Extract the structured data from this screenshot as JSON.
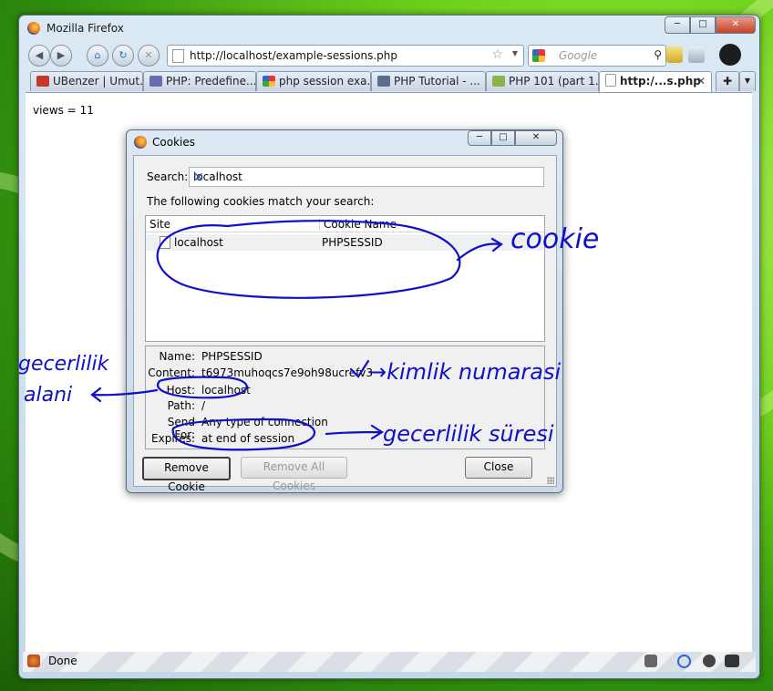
{
  "window": {
    "title": "Mozilla Firefox"
  },
  "nav": {
    "url": "http://localhost/example-sessions.php",
    "search_placeholder": "Google"
  },
  "tabs": [
    {
      "label": "UBenzer | Umut...",
      "icon_color": "#c0392b",
      "icon": "house-icon"
    },
    {
      "label": "PHP: Predefine...",
      "icon_color": "#6b6bb0",
      "icon": "php-icon"
    },
    {
      "label": "php session exa...",
      "icon_color": "#3a8ee6",
      "icon": "google-icon"
    },
    {
      "label": "PHP Tutorial - ...",
      "icon_color": "#5a6e8c",
      "icon": "tutorial-icon"
    },
    {
      "label": "PHP 101 (part 1...",
      "icon_color": "#8ab34a",
      "icon": "zzz-icon"
    },
    {
      "label": "http:/...s.php",
      "icon_color": "#ffffff",
      "icon": "page-icon"
    }
  ],
  "page": {
    "views_text": "views = 11"
  },
  "status": {
    "text": "Done"
  },
  "dialog": {
    "title": "Cookies",
    "search_label": "Search:",
    "search_value": "localhost",
    "match_text": "The following cookies match your search:",
    "columns": [
      "Site",
      "Cookie Name"
    ],
    "rows": [
      {
        "site": "localhost",
        "cookie": "PHPSESSID"
      }
    ],
    "details": [
      {
        "key": "Name:",
        "value": "PHPSESSID"
      },
      {
        "key": "Content:",
        "value": "t6973muhoqcs7e9oh98ucrefv3"
      },
      {
        "key": "Host:",
        "value": "localhost"
      },
      {
        "key": "Path:",
        "value": "/"
      },
      {
        "key": "Send For:",
        "value": "Any type of connection"
      },
      {
        "key": "Expires:",
        "value": "at end of session"
      }
    ],
    "buttons": {
      "remove": "Remove Cookie",
      "remove_all": "Remove All Cookies",
      "close": "Close"
    }
  },
  "annotations": {
    "cookie": "cookie",
    "kimlik": "→kimlik numarasi",
    "gecerlilik_alani_1": "gecerlilik",
    "gecerlilik_alani_2": "alani",
    "gecerlilik_suresi": "gecerlilik süresi"
  },
  "colors": {
    "ink": "#1010c8",
    "accent": "#2a5db0"
  }
}
